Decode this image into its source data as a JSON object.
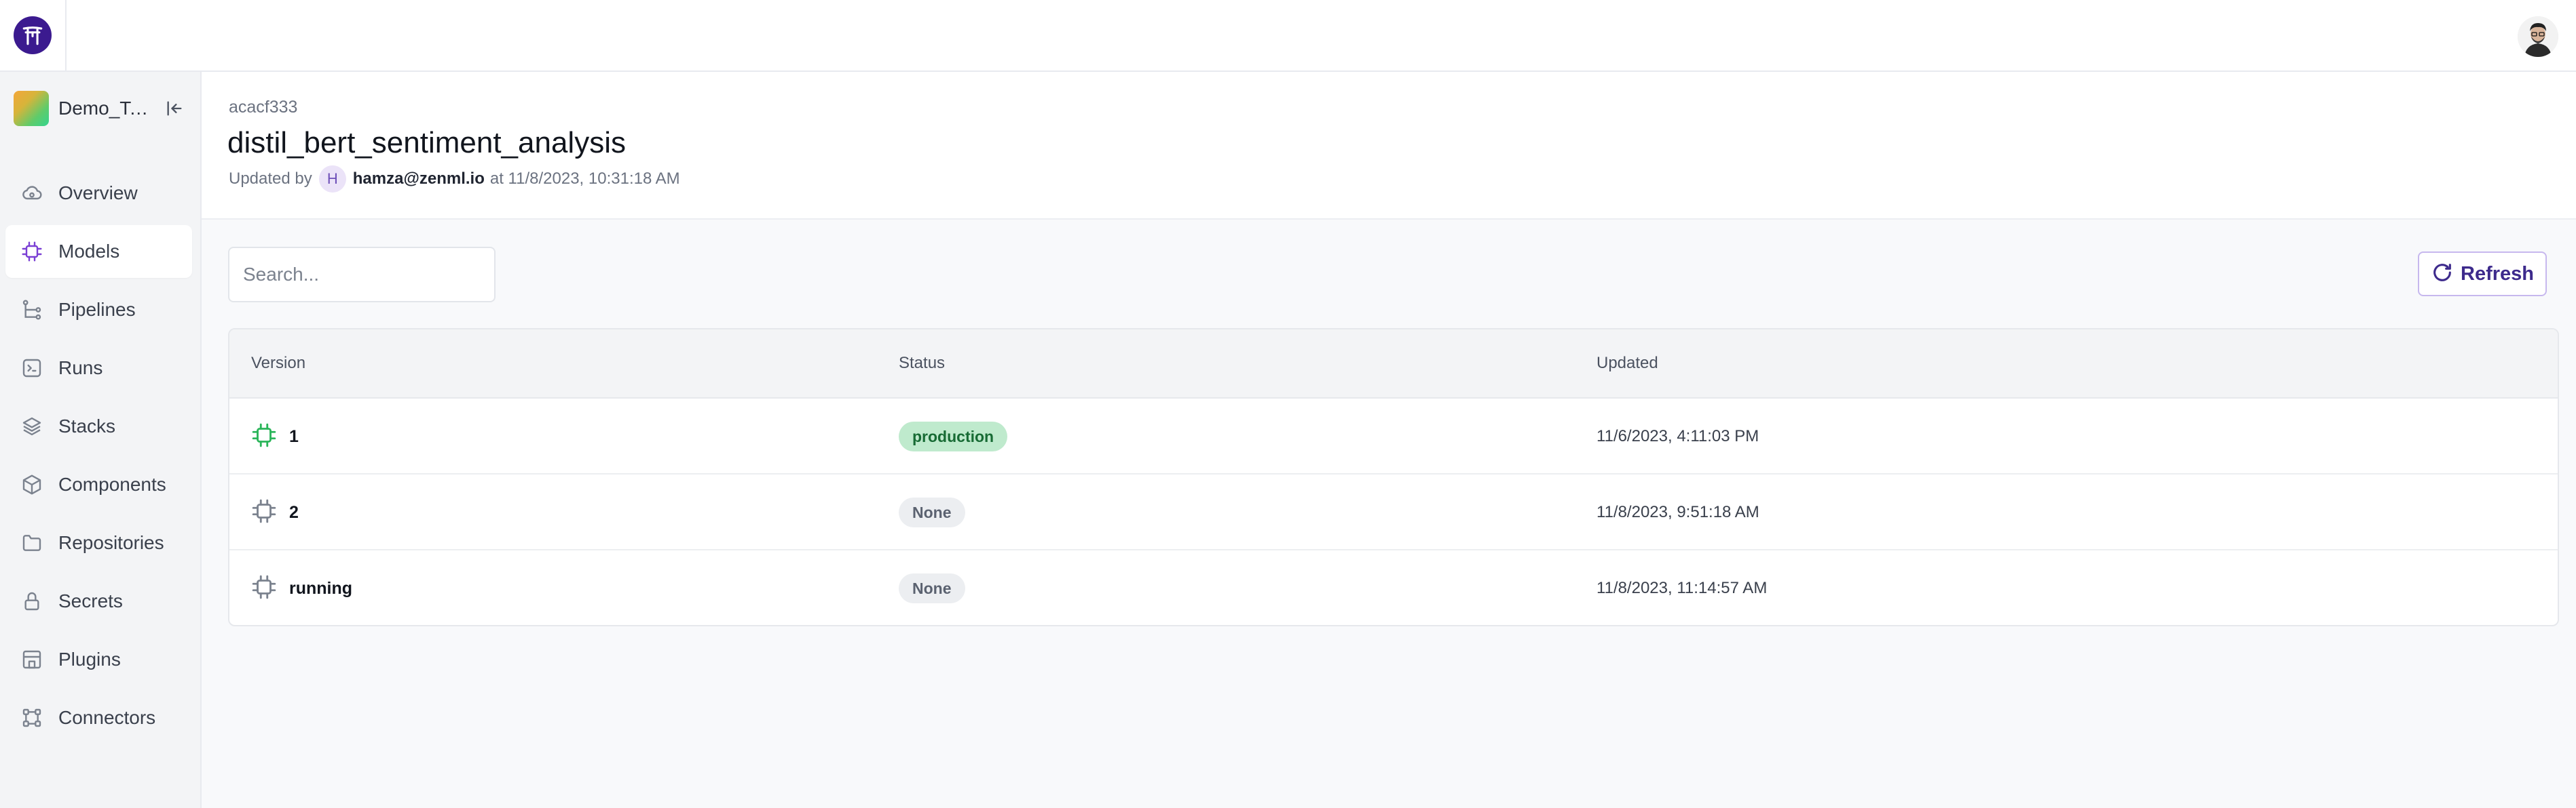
{
  "app": {
    "logo_icon": "torii-gate-icon",
    "user_avatar_icon": "user-avatar-icon"
  },
  "sidebar": {
    "workspace_name": "Demo_Te...",
    "collapse_icon": "collapse-left-icon",
    "items": [
      {
        "label": "Overview",
        "icon": "cloud-icon",
        "active": false
      },
      {
        "label": "Models",
        "icon": "chip-icon",
        "active": true
      },
      {
        "label": "Pipelines",
        "icon": "pipeline-icon",
        "active": false
      },
      {
        "label": "Runs",
        "icon": "terminal-icon",
        "active": false
      },
      {
        "label": "Stacks",
        "icon": "layers-icon",
        "active": false
      },
      {
        "label": "Components",
        "icon": "cube-icon",
        "active": false
      },
      {
        "label": "Repositories",
        "icon": "folder-icon",
        "active": false
      },
      {
        "label": "Secrets",
        "icon": "lock-icon",
        "active": false
      },
      {
        "label": "Plugins",
        "icon": "store-icon",
        "active": false
      },
      {
        "label": "Connectors",
        "icon": "connector-icon",
        "active": false
      }
    ]
  },
  "header": {
    "model_id": "acacf333",
    "title": "distil_bert_sentiment_analysis",
    "updated_prefix": "Updated by",
    "updated_initial": "H",
    "updated_by": "hamza@zenml.io",
    "updated_suffix": "at 11/8/2023, 10:31:18 AM"
  },
  "toolbar": {
    "search_placeholder": "Search...",
    "search_value": "",
    "refresh_label": "Refresh"
  },
  "table": {
    "columns": [
      "Version",
      "Status",
      "Updated"
    ],
    "rows": [
      {
        "version": "1",
        "status": "production",
        "updated": "11/6/2023, 4:11:03 PM"
      },
      {
        "version": "2",
        "status": "None",
        "updated": "11/8/2023, 9:51:18 AM"
      },
      {
        "version": "running",
        "status": "None",
        "updated": "11/8/2023, 11:14:57 AM"
      }
    ]
  },
  "colors": {
    "accent": "#3d2a8c",
    "logo_bg": "#3b1a8f",
    "active_icon": "#7a3fd4",
    "production_badge_bg": "#bfeacd",
    "production_badge_text": "#176b34",
    "none_badge_bg": "#eceef1",
    "version_icon_active": "#2bb55a",
    "version_icon_inactive": "#7b828e"
  }
}
